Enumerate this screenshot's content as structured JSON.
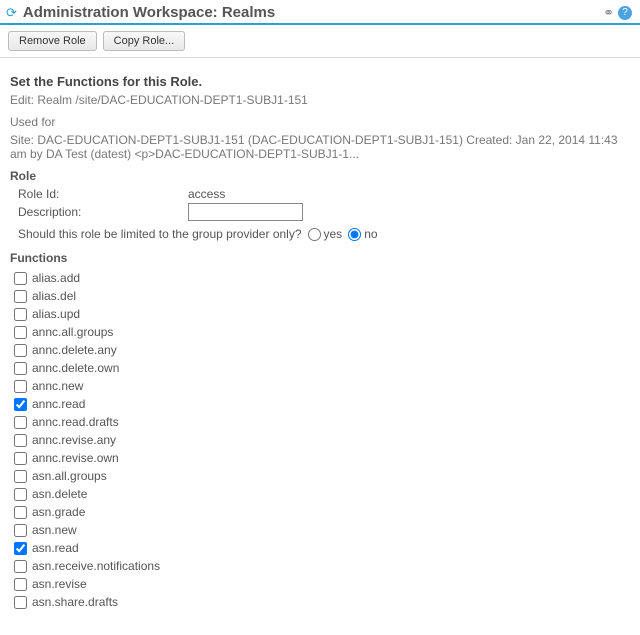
{
  "header": {
    "title": "Administration Workspace: Realms"
  },
  "toolbar": {
    "remove_role": "Remove Role",
    "copy_role": "Copy Role..."
  },
  "main": {
    "heading": "Set the Functions for this Role.",
    "edit_line": "Edit: Realm /site/DAC-EDUCATION-DEPT1-SUBJ1-151",
    "used_for_label": "Used for",
    "used_for_text": "Site: DAC-EDUCATION-DEPT1-SUBJ1-151 (DAC-EDUCATION-DEPT1-SUBJ1-151) Created: Jan 22, 2014 11:43 am by DA Test (datest) <p>DAC-EDUCATION-DEPT1-SUBJ1-1..."
  },
  "role": {
    "section_label": "Role",
    "id_label": "Role Id:",
    "id_value": "access",
    "description_label": "Description:",
    "description_value": "",
    "limit_question": "Should this role be limited to the group provider only?",
    "yes_label": "yes",
    "no_label": "no",
    "limit_selected": "no"
  },
  "functions": {
    "section_label": "Functions",
    "items": [
      {
        "name": "alias.add",
        "checked": false
      },
      {
        "name": "alias.del",
        "checked": false
      },
      {
        "name": "alias.upd",
        "checked": false
      },
      {
        "name": "annc.all.groups",
        "checked": false
      },
      {
        "name": "annc.delete.any",
        "checked": false
      },
      {
        "name": "annc.delete.own",
        "checked": false
      },
      {
        "name": "annc.new",
        "checked": false
      },
      {
        "name": "annc.read",
        "checked": true
      },
      {
        "name": "annc.read.drafts",
        "checked": false
      },
      {
        "name": "annc.revise.any",
        "checked": false
      },
      {
        "name": "annc.revise.own",
        "checked": false
      },
      {
        "name": "asn.all.groups",
        "checked": false
      },
      {
        "name": "asn.delete",
        "checked": false
      },
      {
        "name": "asn.grade",
        "checked": false
      },
      {
        "name": "asn.new",
        "checked": false
      },
      {
        "name": "asn.read",
        "checked": true
      },
      {
        "name": "asn.receive.notifications",
        "checked": false
      },
      {
        "name": "asn.revise",
        "checked": false
      },
      {
        "name": "asn.share.drafts",
        "checked": false
      }
    ]
  }
}
